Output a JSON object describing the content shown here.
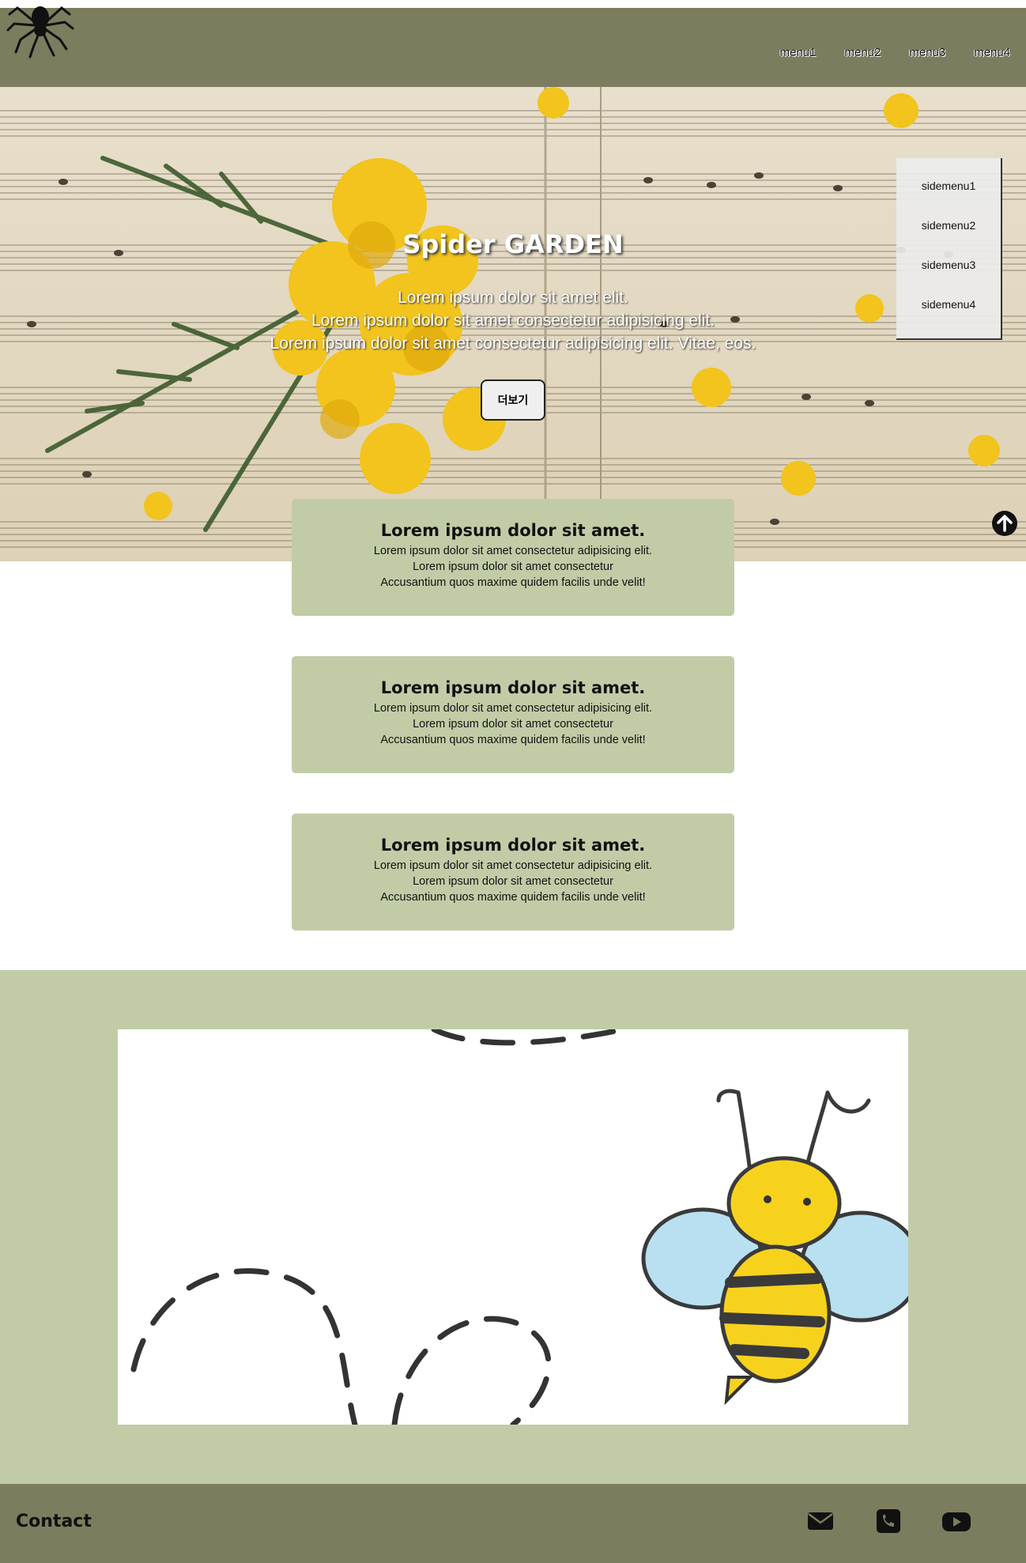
{
  "header": {
    "logo_icon": "spider-icon",
    "nav": [
      "menu1",
      "menu2",
      "menu3",
      "menu4"
    ]
  },
  "hero": {
    "title": "Spider GARDEN",
    "lines": [
      "Lorem ipsum dolor sit amet elit.",
      "Lorem ipsum dolor sit amet consectetur adipisicing elit.",
      "Lorem ipsum dolor sit amet consectetur adipisicing elit. Vitae, eos."
    ],
    "button_label": "더보기"
  },
  "sidemenu": [
    "sidemenu1",
    "sidemenu2",
    "sidemenu3",
    "sidemenu4"
  ],
  "cards": [
    {
      "title": "Lorem ipsum dolor sit amet.",
      "lines": [
        "Lorem ipsum dolor sit amet consectetur adipisicing elit.",
        "Lorem ipsum dolor sit amet consectetur",
        "Accusantium quos maxime quidem facilis unde velit!"
      ]
    },
    {
      "title": "Lorem ipsum dolor sit amet.",
      "lines": [
        "Lorem ipsum dolor sit amet consectetur adipisicing elit.",
        "Lorem ipsum dolor sit amet consectetur",
        "Accusantium quos maxime quidem facilis unde velit!"
      ]
    },
    {
      "title": "Lorem ipsum dolor sit amet.",
      "lines": [
        "Lorem ipsum dolor sit amet consectetur adipisicing elit.",
        "Lorem ipsum dolor sit amet consectetur",
        "Accusantium quos maxime quidem facilis unde velit!"
      ]
    }
  ],
  "footer": {
    "title": "Contact",
    "icons": [
      "envelope-icon",
      "phone-icon",
      "youtube-icon"
    ]
  },
  "colors": {
    "header_bg": "#7b7d5e",
    "card_bg": "#c1cca7",
    "section_bg": "#c1cca7"
  }
}
